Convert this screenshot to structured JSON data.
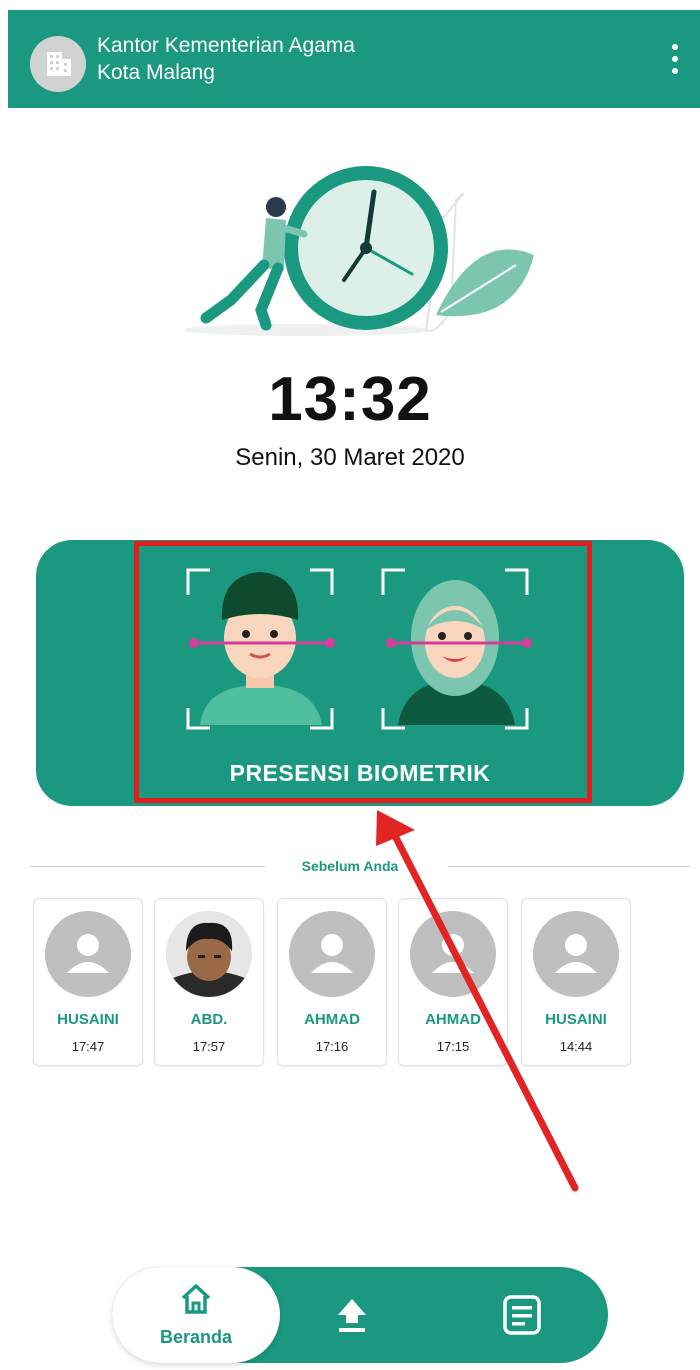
{
  "appbar": {
    "title_line1": "Kantor Kementerian Agama",
    "title_line2": "Kota Malang",
    "avatar_icon": "building-icon",
    "menu_icon": "more-vertical-icon"
  },
  "clock": {
    "time": "13:32",
    "date": "Senin, 30 Maret 2020"
  },
  "biometric": {
    "label": "PRESENSI BIOMETRIK"
  },
  "recent": {
    "header": "Sebelum Anda",
    "items": [
      {
        "name": "HUSAINI",
        "time": "17:47",
        "avatar": "default-user"
      },
      {
        "name": "ABD.",
        "time": "17:57",
        "avatar": "photo"
      },
      {
        "name": "AHMAD",
        "time": "17:16",
        "avatar": "default-user"
      },
      {
        "name": "AHMAD",
        "time": "17:15",
        "avatar": "default-user"
      },
      {
        "name": "HUSAINI",
        "time": "14:44",
        "avatar": "default-user"
      }
    ]
  },
  "bottom_nav": {
    "home_label": "Beranda",
    "home_icon": "home-icon",
    "upload_icon": "upload-icon",
    "list_icon": "document-list-icon"
  },
  "colors": {
    "primary": "#1a9980",
    "highlight": "#e01e1e"
  }
}
